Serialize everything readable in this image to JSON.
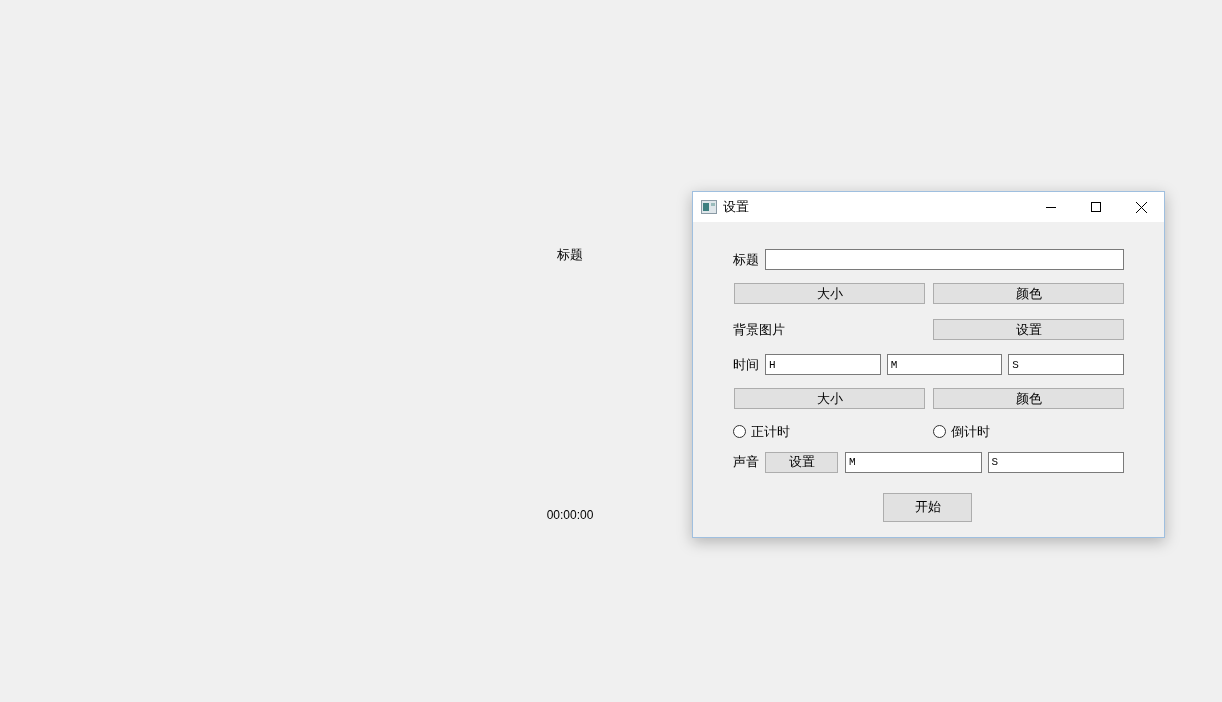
{
  "main": {
    "title": "标题",
    "timer": "00:00:00"
  },
  "dialog": {
    "title": "设置",
    "title_row": {
      "label": "标题"
    },
    "title_style_buttons": [
      "大小",
      "颜色"
    ],
    "background_row": {
      "label": "背景图片",
      "button": "设置"
    },
    "time_row": {
      "label": "时间",
      "fields": [
        "H",
        "M",
        "S"
      ]
    },
    "time_style_buttons": [
      "大小",
      "颜色"
    ],
    "modes": [
      {
        "label": "正计时",
        "selected": false
      },
      {
        "label": "倒计时",
        "selected": false
      }
    ],
    "sound_row": {
      "label": "声音",
      "button": "设置",
      "fields": [
        "M",
        "S"
      ]
    },
    "start_button": "开始"
  }
}
